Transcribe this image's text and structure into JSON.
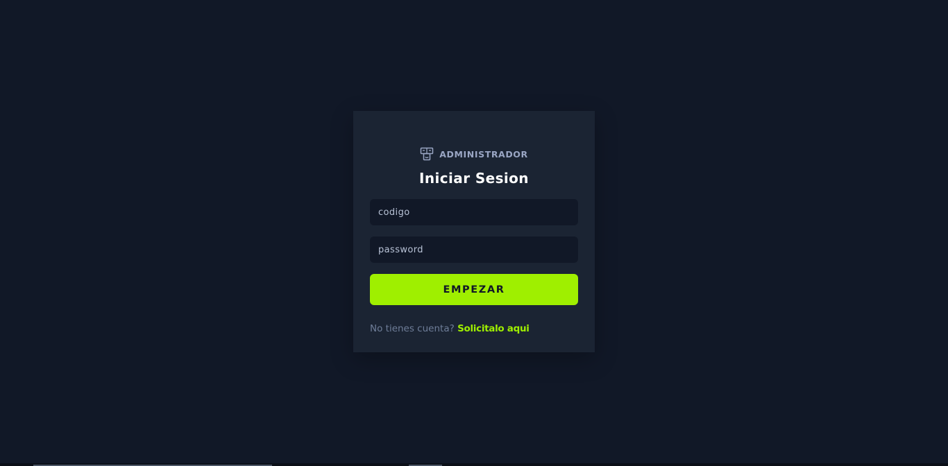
{
  "brand": {
    "icon": "mask-faces-icon",
    "label": "ADMINISTRADOR"
  },
  "login": {
    "title": "Iniciar Sesion",
    "code_placeholder": "codigo",
    "password_placeholder": "password",
    "submit_label": "EMPEZAR",
    "footer_text": "No tienes cuenta?",
    "footer_link": "Solicitalo aqui"
  },
  "colors": {
    "background": "#111827",
    "card": "#1b2433",
    "accent": "#9fef00",
    "muted_text": "#6f7e99"
  }
}
